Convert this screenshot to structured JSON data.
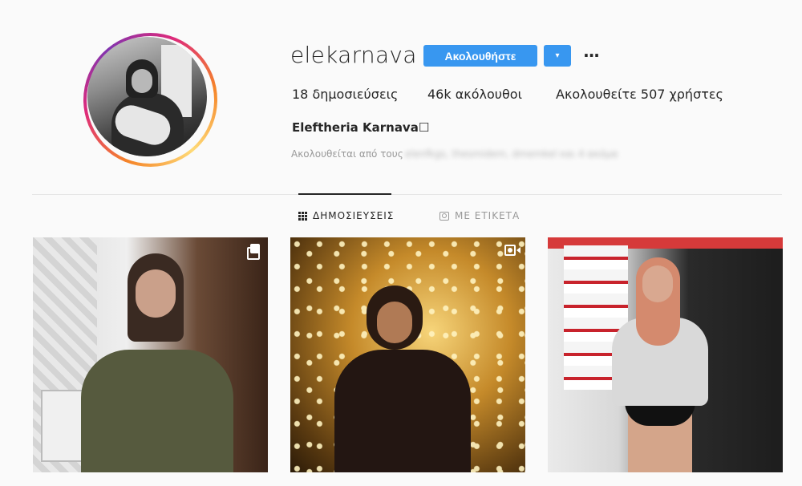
{
  "profile": {
    "username": "elekarnava",
    "follow_label": "Ακολουθήστε",
    "dropdown_label": "▾",
    "more_label": "···",
    "stats": {
      "posts": "18 δημοσιεύσεις",
      "followers": "46k ακόλουθοι",
      "following": "Ακολουθείτε 507 χρήστες"
    },
    "full_name": "Eleftheria Karnava☐",
    "followed_by_prefix": "Ακολουθείται από τους",
    "followed_by_names": "elenfkgs, thesmidem, dmemkel και 4 ακόμα"
  },
  "tabs": [
    {
      "label": "ΔΗΜΟΣΙΕΥΣΕΙΣ",
      "active": true
    },
    {
      "label": "ΜΕ ΕΤΙΚΕΤΑ",
      "active": false
    }
  ],
  "posts": [
    {
      "type": "carousel",
      "icon": "multiple-photos-icon"
    },
    {
      "type": "video",
      "icon": "video-camera-icon"
    },
    {
      "type": "photo"
    }
  ],
  "colors": {
    "accent": "#3897f0",
    "text": "#262626",
    "muted": "#999999",
    "background": "#fafafa"
  }
}
